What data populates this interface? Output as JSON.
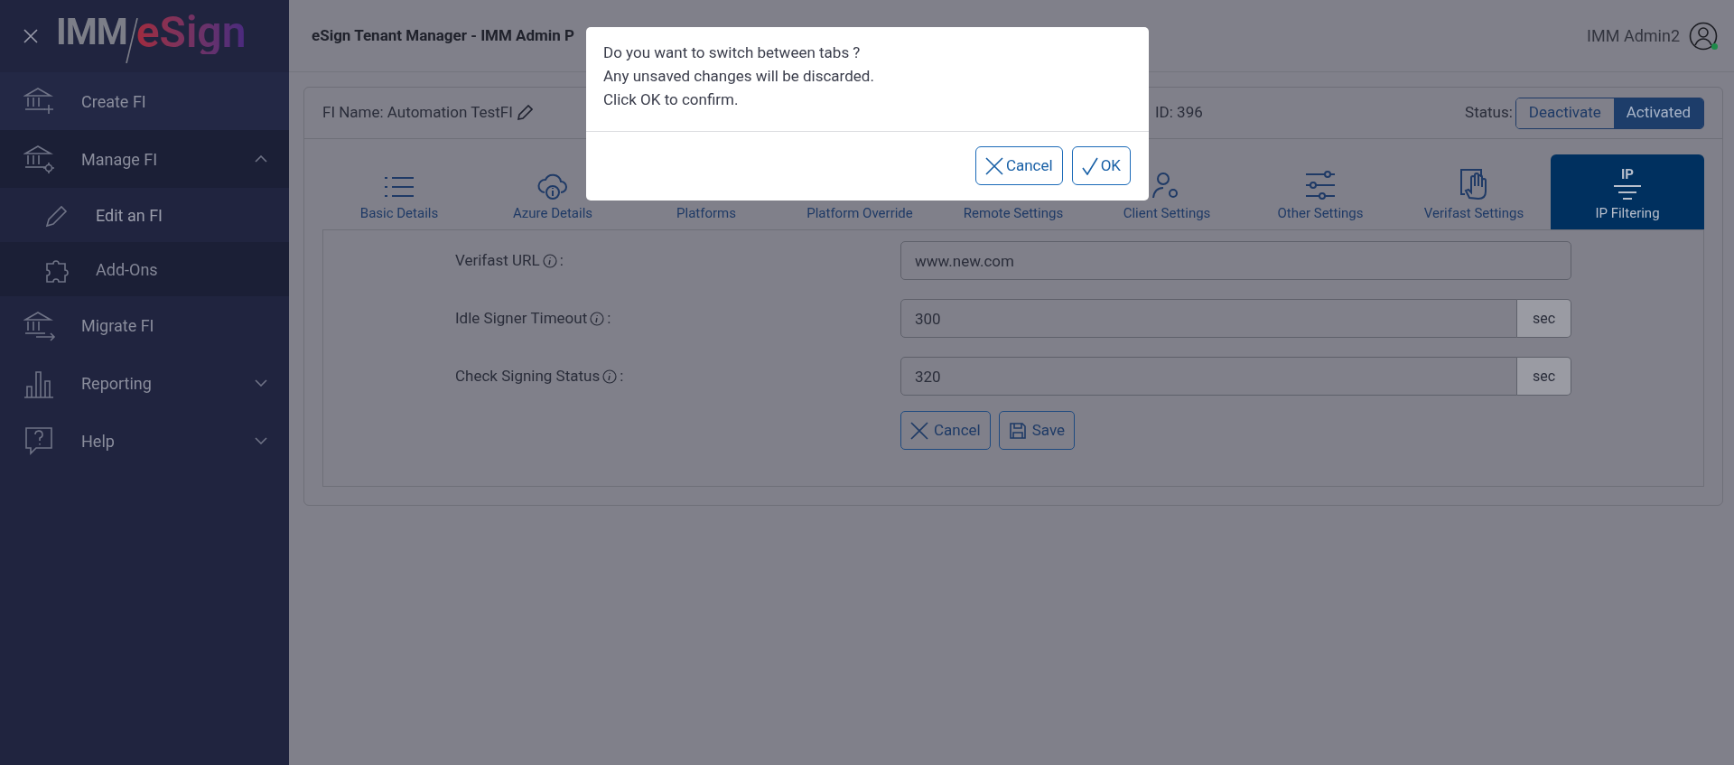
{
  "logo": {
    "prefix": "IMM",
    "name": "eSign"
  },
  "sidebar": {
    "items": [
      {
        "label": "Create FI"
      },
      {
        "label": "Manage FI",
        "expanded": true,
        "children": [
          {
            "label": "Edit an FI",
            "selected": true
          },
          {
            "label": "Add-Ons",
            "selected": false
          }
        ]
      },
      {
        "label": "Migrate FI"
      },
      {
        "label": "Reporting",
        "expanded": false
      },
      {
        "label": "Help",
        "expanded": false
      }
    ]
  },
  "header": {
    "title": "eSign Tenant Manager - IMM Admin P",
    "user": "IMM Admin2",
    "online": true
  },
  "fi": {
    "name": "FI Name: Automation TestFI",
    "id": "ID: 396",
    "status_label": "Status:",
    "status_options": [
      {
        "label": "Deactivate",
        "selected": false
      },
      {
        "label": "Activated",
        "selected": true
      }
    ]
  },
  "tabs": [
    {
      "label": "Basic Details",
      "selected": false
    },
    {
      "label": "Azure Details",
      "selected": false
    },
    {
      "label": "Platforms",
      "selected": false
    },
    {
      "label": "Platform Override",
      "selected": false
    },
    {
      "label": "Remote Settings",
      "selected": false
    },
    {
      "label": "Client Settings",
      "selected": false
    },
    {
      "label": "Other Settings",
      "selected": false
    },
    {
      "label": "Verifast Settings",
      "selected": false
    },
    {
      "label": "IP Filtering",
      "icon_text": "IP",
      "selected": true
    }
  ],
  "form": {
    "fields": [
      {
        "label": "Verifast URL",
        "value": "www.new.com"
      },
      {
        "label": "Idle Signer Timeout",
        "value": "300",
        "unit": "sec"
      },
      {
        "label": "Check Signing Status",
        "value": "320",
        "unit": "sec"
      }
    ],
    "colon": ":",
    "buttons": [
      {
        "label": "Cancel",
        "kind": "cancel"
      },
      {
        "label": "Save",
        "kind": "save"
      }
    ]
  },
  "dialog": {
    "lines": [
      "Do you want to switch between tabs ?",
      "Any unsaved changes will be discarded.",
      "Click OK to confirm."
    ],
    "buttons": [
      {
        "label": "Cancel",
        "kind": "cancel"
      },
      {
        "label": "OK",
        "kind": "ok"
      }
    ]
  }
}
